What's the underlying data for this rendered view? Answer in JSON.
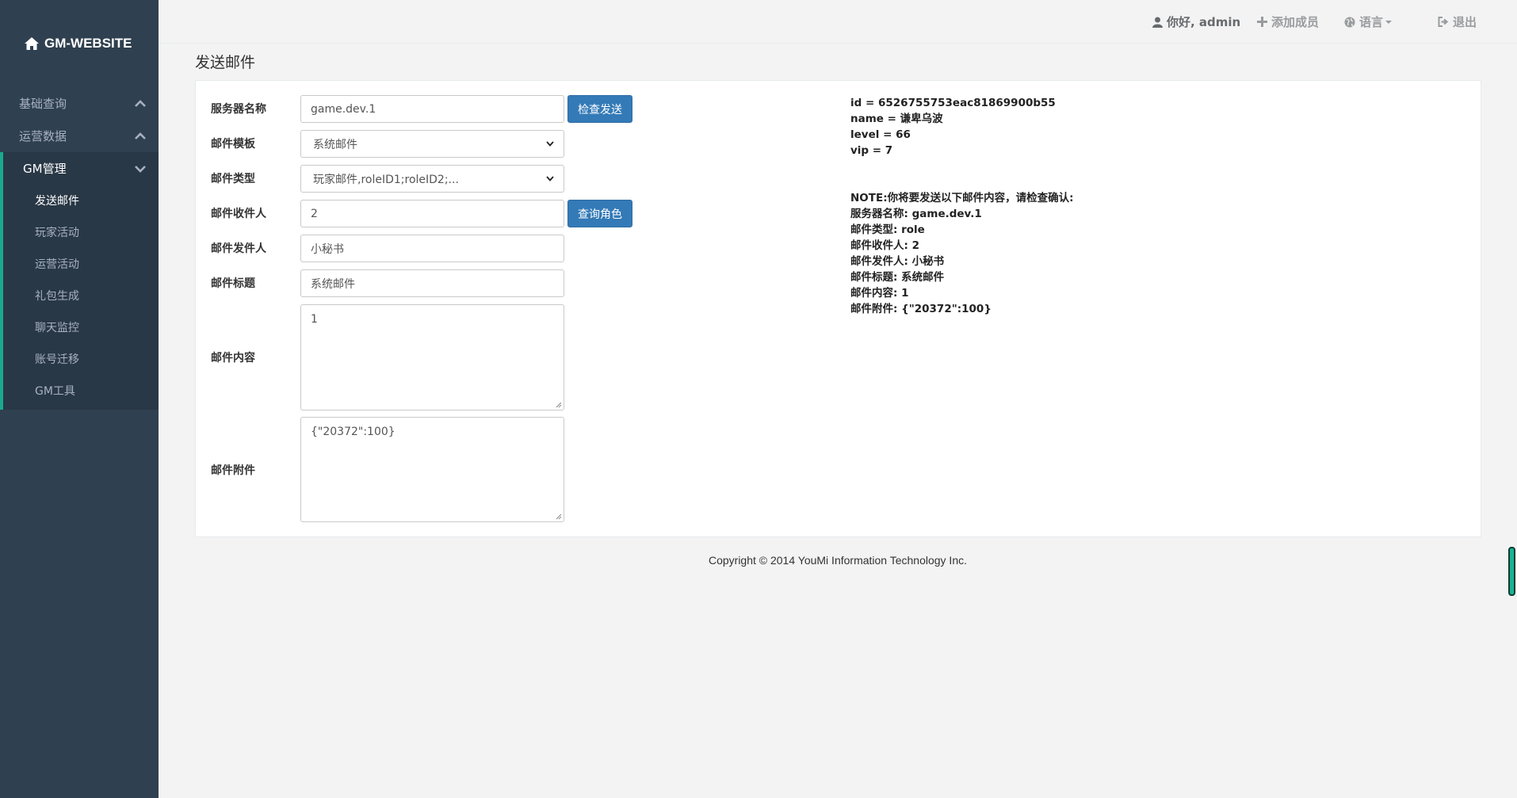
{
  "brand": {
    "title": "GM-WEBSITE"
  },
  "sidebar": {
    "groups": [
      {
        "label": "基础查询"
      },
      {
        "label": "运营数据"
      },
      {
        "label": "GM管理"
      }
    ],
    "items": [
      {
        "label": "发送邮件"
      },
      {
        "label": "玩家活动"
      },
      {
        "label": "运营活动"
      },
      {
        "label": "礼包生成"
      },
      {
        "label": "聊天监控"
      },
      {
        "label": "账号迁移"
      },
      {
        "label": "GM工具"
      }
    ]
  },
  "topbar": {
    "greeting": "你好, admin",
    "add_member": "添加成员",
    "language": "语言",
    "logout": "退出"
  },
  "page": {
    "title": "发送邮件"
  },
  "form": {
    "server_label": "服务器名称",
    "server_value": "game.dev.1",
    "check_send_button": "检查发送",
    "template_label": "邮件模板",
    "template_value": "系统邮件",
    "type_label": "邮件类型",
    "type_value": "玩家邮件,roleID1;roleID2;...",
    "recipient_label": "邮件收件人",
    "recipient_value": "2",
    "query_role_button": "查询角色",
    "sender_label": "邮件发件人",
    "sender_value": "小秘书",
    "subject_label": "邮件标题",
    "subject_value": "系统邮件",
    "content_label": "邮件内容",
    "content_value": "1",
    "attachment_label": "邮件附件",
    "attachment_value": "{\"20372\":100}"
  },
  "role_info": [
    "id = 6526755753eac81869900b55",
    "name = 谦卑乌波",
    "level = 66",
    "vip = 7"
  ],
  "confirm_info": [
    "NOTE:你将要发送以下邮件内容，请检查确认:",
    "服务器名称: game.dev.1",
    "邮件类型: role",
    "邮件收件人: 2",
    "邮件发件人: 小秘书",
    "邮件标题: 系统邮件",
    "邮件内容: 1",
    "邮件附件: {\"20372\":100}"
  ],
  "footer": {
    "copyright": "Copyright © 2014 YouMi Information Technology Inc."
  },
  "colors": {
    "sidebar": "#2f4050",
    "accent": "#19aa8d",
    "primary_button": "#337ab7"
  }
}
